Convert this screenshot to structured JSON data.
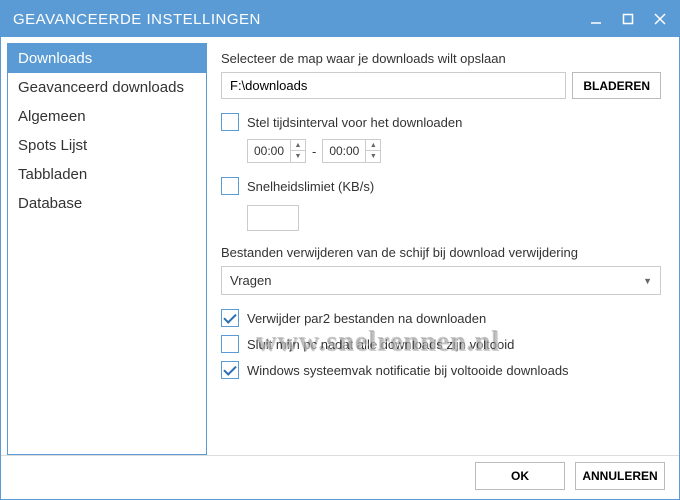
{
  "window": {
    "title": "GEAVANCEERDE INSTELLINGEN"
  },
  "sidebar": {
    "items": [
      {
        "label": "Downloads",
        "active": true
      },
      {
        "label": "Geavanceerd downloads",
        "active": false
      },
      {
        "label": "Algemeen",
        "active": false
      },
      {
        "label": "Spots Lijst",
        "active": false
      },
      {
        "label": "Tabbladen",
        "active": false
      },
      {
        "label": "Database",
        "active": false
      }
    ]
  },
  "content": {
    "folder_label": "Selecteer de map waar je downloads wilt opslaan",
    "folder_path": "F:\\downloads",
    "browse": "BLADEREN",
    "interval_label": "Stel tijdsinterval voor het downloaden",
    "interval_from": "00:00",
    "interval_sep": "-",
    "interval_to": "00:00",
    "speed_label": "Snelheidslimiet (KB/s)",
    "speed_value": "",
    "delete_label": "Bestanden verwijderen van de schijf bij download verwijdering",
    "delete_option": "Vragen",
    "opt_par2": "Verwijder par2 bestanden na downloaden",
    "opt_shutdown": "Sluit mijn pc nadat alle downloads zijn voltooid",
    "opt_tray": "Windows systeemvak notificatie bij voltooide downloads"
  },
  "checks": {
    "interval": false,
    "speed": false,
    "par2": true,
    "shutdown": false,
    "tray": true
  },
  "footer": {
    "ok": "OK",
    "cancel": "ANNULEREN"
  },
  "watermark": "www.snelrennen.nl"
}
